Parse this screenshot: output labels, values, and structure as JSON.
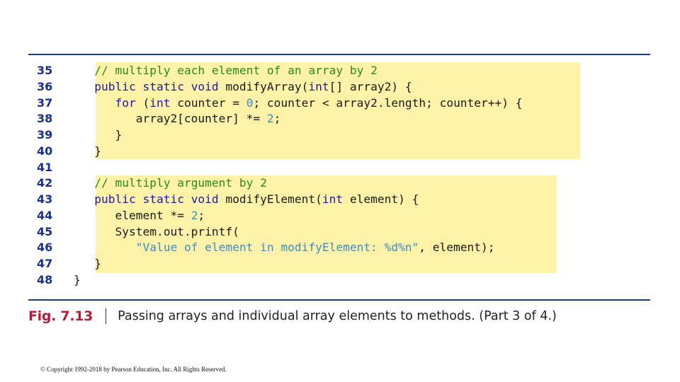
{
  "line_numbers": [
    "35",
    "36",
    "37",
    "38",
    "39",
    "40",
    "41",
    "42",
    "43",
    "44",
    "45",
    "46",
    "47",
    "48"
  ],
  "code_lines": [
    [
      {
        "t": "   ",
        "c": ""
      },
      {
        "t": "// multiply each element of an array by 2",
        "c": "cm"
      }
    ],
    [
      {
        "t": "   ",
        "c": ""
      },
      {
        "t": "public static void",
        "c": "kw"
      },
      {
        "t": " modifyArray(",
        "c": ""
      },
      {
        "t": "int",
        "c": "kw"
      },
      {
        "t": "[] array2) {",
        "c": ""
      }
    ],
    [
      {
        "t": "      ",
        "c": ""
      },
      {
        "t": "for",
        "c": "kw"
      },
      {
        "t": " (",
        "c": ""
      },
      {
        "t": "int",
        "c": "kw"
      },
      {
        "t": " counter = ",
        "c": ""
      },
      {
        "t": "0",
        "c": "num"
      },
      {
        "t": "; counter < array2.length; counter++) {",
        "c": ""
      }
    ],
    [
      {
        "t": "         array2[counter] *= ",
        "c": ""
      },
      {
        "t": "2",
        "c": "num"
      },
      {
        "t": ";",
        "c": ""
      }
    ],
    [
      {
        "t": "      }",
        "c": ""
      }
    ],
    [
      {
        "t": "   }",
        "c": ""
      }
    ],
    [
      {
        "t": "",
        "c": ""
      }
    ],
    [
      {
        "t": "   ",
        "c": ""
      },
      {
        "t": "// multiply argument by 2",
        "c": "cm"
      }
    ],
    [
      {
        "t": "   ",
        "c": ""
      },
      {
        "t": "public static void",
        "c": "kw"
      },
      {
        "t": " modifyElement(",
        "c": ""
      },
      {
        "t": "int",
        "c": "kw"
      },
      {
        "t": " element) {",
        "c": ""
      }
    ],
    [
      {
        "t": "      element *= ",
        "c": ""
      },
      {
        "t": "2",
        "c": "num"
      },
      {
        "t": ";",
        "c": ""
      }
    ],
    [
      {
        "t": "      System.out.printf(",
        "c": ""
      }
    ],
    [
      {
        "t": "         ",
        "c": ""
      },
      {
        "t": "\"Value of element in modifyElement: %d%n\"",
        "c": "str"
      },
      {
        "t": ", element);",
        "c": ""
      }
    ],
    [
      {
        "t": "   }",
        "c": ""
      }
    ],
    [
      {
        "t": "}",
        "c": ""
      }
    ]
  ],
  "caption": {
    "label": "Fig. 7.13",
    "text": "Passing arrays and individual array elements to methods. (Part 3 of 4.)"
  },
  "copyright": "© Copyright 1992-2018 by Pearson Education, Inc. All Rights Reserved."
}
